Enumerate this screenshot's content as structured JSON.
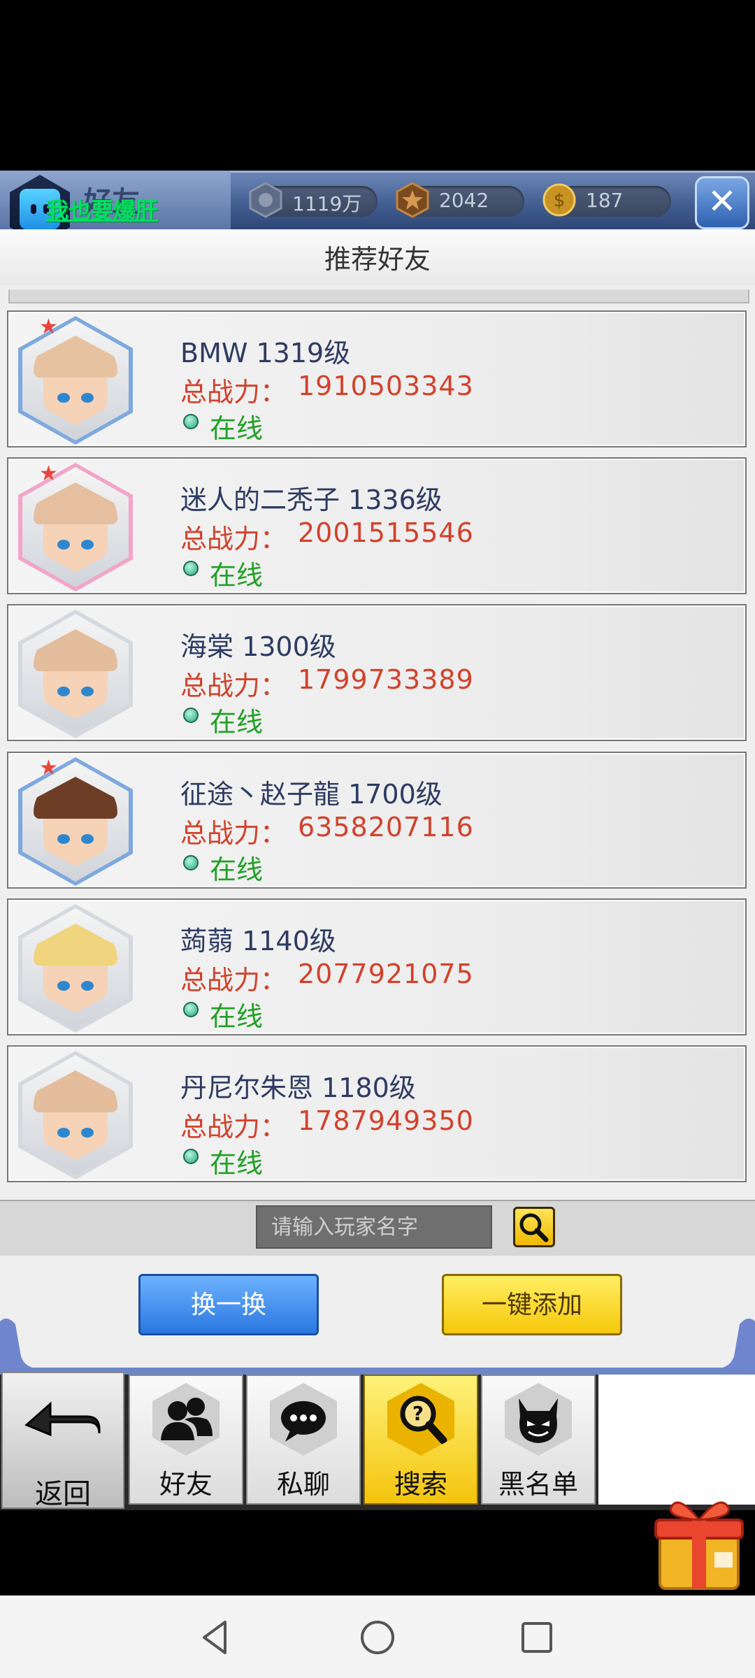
{
  "header": {
    "left_label": "好友",
    "promo_link": "我也要爆肝",
    "currencies": [
      {
        "icon": "coin-shield-icon",
        "value": "1119万"
      },
      {
        "icon": "honor-medal-icon",
        "value": "2042"
      },
      {
        "icon": "gold-coin-icon",
        "value": "187"
      }
    ],
    "close_label": "✕"
  },
  "panel": {
    "title": "推荐好友"
  },
  "friends": [
    {
      "name": "BMW 1319级",
      "power_label": "总战力：",
      "power": "1910503343",
      "status": "在线",
      "hair": "#e7c2a0",
      "frame": "#7ea9e0",
      "star": true
    },
    {
      "name": "迷人的二秃子 1336级",
      "power_label": "总战力：",
      "power": "2001515546",
      "status": "在线",
      "hair": "#e5bfa0",
      "frame": "#f2a5c8",
      "star": true
    },
    {
      "name": "海棠 1300级",
      "power_label": "总战力：",
      "power": "1799733389",
      "status": "在线",
      "hair": "#e3bd9c",
      "frame": "#d5d8de",
      "star": false
    },
    {
      "name": "征途丶赵子龍 1700级",
      "power_label": "总战力：",
      "power": "6358207116",
      "status": "在线",
      "hair": "#6e3d26",
      "frame": "#7ea9e0",
      "star": true
    },
    {
      "name": "蒟蒻 1140级",
      "power_label": "总战力：",
      "power": "2077921075",
      "status": "在线",
      "hair": "#f0d57e",
      "frame": "#d5d8de",
      "star": false
    },
    {
      "name": "丹尼尔朱恩 1180级",
      "power_label": "总战力：",
      "power": "1787949350",
      "status": "在线",
      "hair": "#e3bd9c",
      "frame": "#d5d8de",
      "star": false
    }
  ],
  "search": {
    "placeholder": "请输入玩家名字"
  },
  "actions": {
    "refresh_label": "换一换",
    "add_all_label": "一键添加"
  },
  "nav": {
    "back_label": "返回",
    "tabs": [
      {
        "label": "好友",
        "icon": "friends-icon"
      },
      {
        "label": "私聊",
        "icon": "chat-bubble-icon"
      },
      {
        "label": "搜索",
        "icon": "search-question-icon"
      },
      {
        "label": "黑名单",
        "icon": "devil-icon"
      }
    ],
    "active": "搜索"
  },
  "colors": {
    "name": "#2d3b63",
    "power": "#d2412b",
    "online": "#21a026",
    "accent_yellow": "#f6c80a",
    "accent_blue": "#2a78e0"
  }
}
